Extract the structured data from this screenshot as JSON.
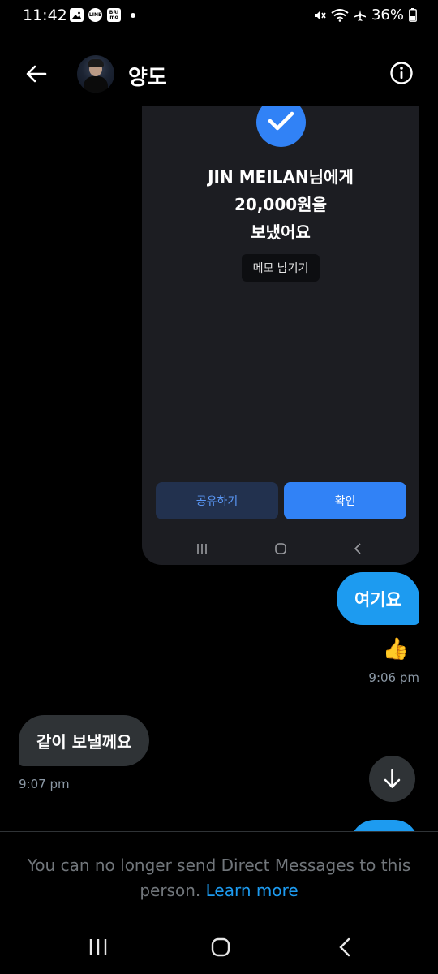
{
  "status_bar": {
    "time": "11:42",
    "notif_icons": [
      "gallery-icon",
      "line-icon",
      "brimo-icon"
    ],
    "line_label": "LINE",
    "brimo_label": "BRI mo",
    "battery": "36%"
  },
  "header": {
    "contact_name": "양도"
  },
  "shared_screenshot": {
    "line1": "JIN MEILAN님에게",
    "line2": "20,000원을",
    "line3": "보냈어요",
    "memo_button": "메모 남기기",
    "share_button": "공유하기",
    "confirm_button": "확인",
    "accent_color": "#3182f6"
  },
  "messages": {
    "sent_text": "여기요",
    "reaction": "👍",
    "sent_time": "9:06 pm",
    "received_text": "같이 보낼께요",
    "received_time": "9:07 pm",
    "sent_bubble_color": "#1d9bf0",
    "received_bubble_color": "#2f3336"
  },
  "notice": {
    "text": "You can no longer send Direct Messages to this person.",
    "link": "Learn more"
  }
}
